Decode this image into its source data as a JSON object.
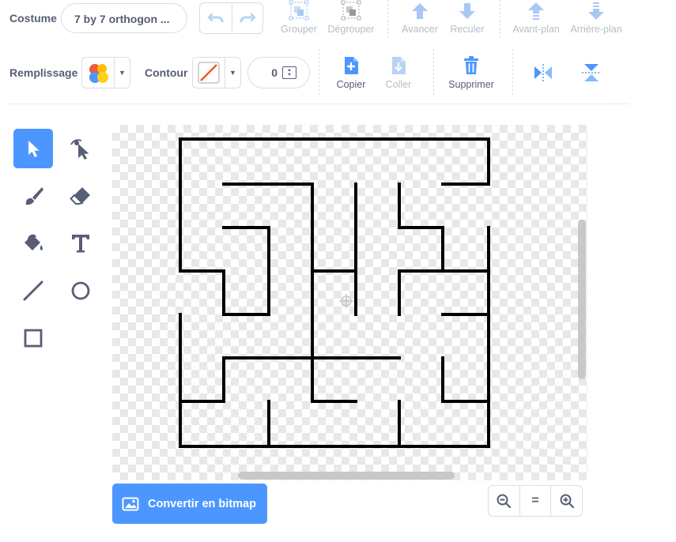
{
  "costume": {
    "label": "Costume",
    "name": "7 by 7 orthogon ..."
  },
  "toolbar_top": {
    "group": "Grouper",
    "ungroup": "Dégrouper",
    "forward": "Avancer",
    "backward": "Reculer",
    "front": "Avant-plan",
    "back": "Arrière-plan"
  },
  "toolbar_second": {
    "fill_label": "Remplissage",
    "outline_label": "Contour",
    "outline_width": "0",
    "copy": "Copier",
    "paste": "Coller",
    "delete": "Supprimer"
  },
  "tools": [
    "select",
    "reshape",
    "brush",
    "eraser",
    "fill",
    "text",
    "line",
    "circle",
    "rectangle"
  ],
  "selected_tool": "select",
  "canvas": {
    "convert_button": "Convertir en bitmap"
  },
  "zoom": {
    "out": "zoom-out",
    "reset": "=",
    "in": "zoom-in"
  },
  "colors": {
    "accent": "#4c97ff",
    "text": "#575e75",
    "disabled": "#b8bcc6",
    "outline_slash": "#f05a23"
  }
}
